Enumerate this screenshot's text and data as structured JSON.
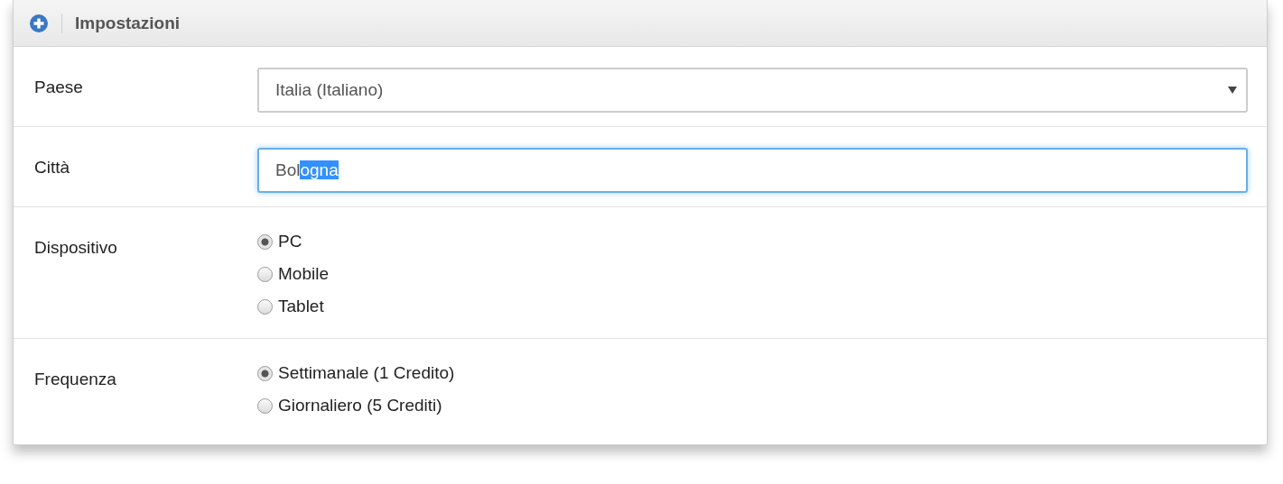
{
  "panel": {
    "title": "Impostazioni"
  },
  "rows": [
    {
      "kind": "select",
      "label": "Paese",
      "value": "Italia (Italiano)"
    },
    {
      "kind": "text",
      "label": "Città",
      "focused": true,
      "value_unselected": "Bol",
      "value_selected": "ogna"
    },
    {
      "kind": "radio",
      "label": "Dispositivo",
      "options": [
        {
          "label": "PC",
          "selected": true
        },
        {
          "label": "Mobile",
          "selected": false
        },
        {
          "label": "Tablet",
          "selected": false
        }
      ]
    },
    {
      "kind": "radio",
      "label": "Frequenza",
      "options": [
        {
          "label": "Settimanale (1 Credito)",
          "selected": true
        },
        {
          "label": "Giornaliero (5 Crediti)",
          "selected": false
        }
      ]
    }
  ]
}
